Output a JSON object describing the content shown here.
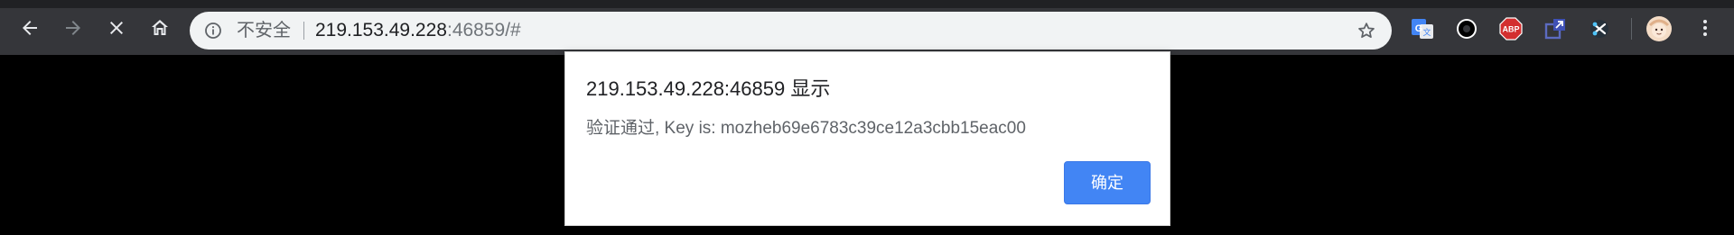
{
  "browser": {
    "security_label": "不安全",
    "url_host": "219.153.49.228",
    "url_rest": ":46859/#"
  },
  "toolbar_icons": {
    "back": "back-arrow-icon",
    "forward": "forward-arrow-icon",
    "stop": "close-icon",
    "home": "home-icon",
    "info": "info-icon",
    "bookmark": "star-icon",
    "menu": "more-vert-icon"
  },
  "extensions": [
    {
      "name": "google-translate-extension-icon",
      "label": "G",
      "color": "#4285f4"
    },
    {
      "name": "circle-extension-icon",
      "label": "",
      "color": "#000000"
    },
    {
      "name": "adblock-plus-extension-icon",
      "label": "ABP",
      "color": "#d32f2f"
    },
    {
      "name": "share-extension-icon",
      "label": "",
      "color": "#3f51b5"
    },
    {
      "name": "scissors-extension-icon",
      "label": "",
      "color": "#ffffff"
    }
  ],
  "dialog": {
    "title": "219.153.49.228:46859 显示",
    "message": "验证通过, Key is: mozheb69e6783c39ce12a3cbb15eac00",
    "ok_label": "确定"
  },
  "colors": {
    "toolbar": "#35363a",
    "omnibox": "#f1f3f4",
    "button": "#4285f4",
    "page": "#000000"
  }
}
